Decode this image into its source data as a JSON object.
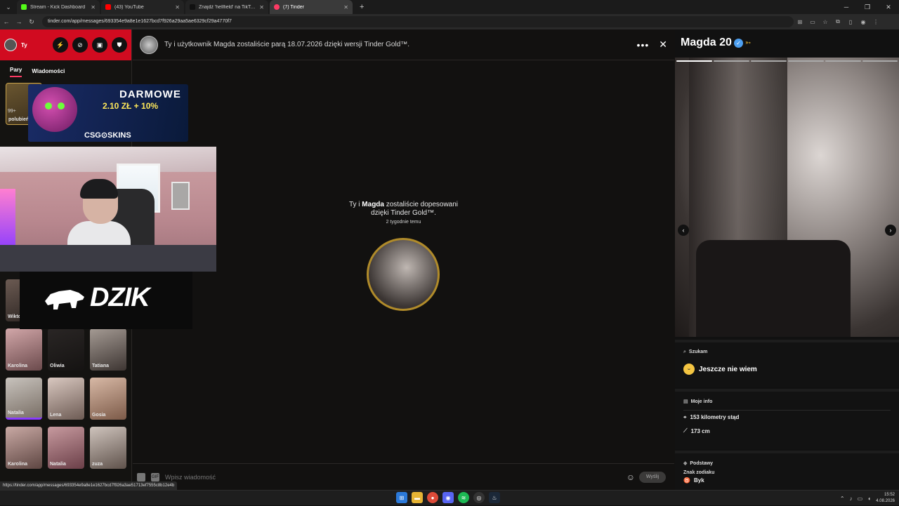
{
  "browser": {
    "tabs": [
      {
        "title": "Stream - Kick Dashboard",
        "color": "#53fc18"
      },
      {
        "title": "(43) YouTube",
        "color": "#ff0000"
      },
      {
        "title": "Znajdź 'hellfield' na TikTok | Wy...",
        "color": "#111111"
      },
      {
        "title": "(7) Tinder",
        "color": "#fd3a64"
      }
    ],
    "url": "tinder.com/app/messages/693354e9a8e1e1627bcd7f926a29aa5ae6329cf29a4770f7",
    "new_tab": "+"
  },
  "sidebar": {
    "user_name": "Ty",
    "tabs": [
      "Pary",
      "Wiadomości"
    ],
    "likes_count": "99+",
    "likes_label": "polubień",
    "matches": [
      {
        "name": "Wiktoria"
      },
      {
        "name": "Karolina"
      },
      {
        "name": "Oliwia"
      },
      {
        "name": "Tatiana"
      },
      {
        "name": "Natalia"
      },
      {
        "name": "Lena"
      },
      {
        "name": "Gosia"
      },
      {
        "name": "Karolina"
      },
      {
        "name": "Natalia"
      },
      {
        "name": "zuza"
      }
    ]
  },
  "overlay": {
    "ad_line1": "DARMOWE",
    "ad_line2": "2.10 ZŁ + 10%",
    "ad_brand": "CSG⊙SKINS",
    "logo_text": "DZIK"
  },
  "chat": {
    "header_text": "Ty i użytkownik Magda zostaliście parą 18.07.2026 dzięki wersji Tinder Gold™.",
    "match_line_prefix": "Ty i",
    "match_name": "Magda",
    "match_line_suffix": "zostaliście dopesowani",
    "match_line2": "dzięki Tinder Gold™.",
    "match_time": "2 tygodnie temu",
    "input_placeholder": "Wpisz wiadomość",
    "send_label": "Wyślij",
    "gif_label": "GIF"
  },
  "profile": {
    "name": "Magda 20",
    "photo_segments": 6,
    "active_segment": 0,
    "seeking_title": "Szukam",
    "seeking_value": "Jeszcze nie wiem",
    "info_title": "Moje info",
    "distance": "153 kilometry stąd",
    "height": "173 cm",
    "basics_title": "Podstawy",
    "zodiac_label": "Znak zodiaku",
    "zodiac_value": "Byk"
  },
  "status_url": "https://tinder.com/app/messages/693354e9a8e1e1627bcd7f926a3ae51713ef7555c8b12e4b",
  "taskbar": {
    "time": "15:52",
    "date": "4.08.2026"
  },
  "colors": {
    "tinder_red": "#d10b20",
    "gold": "#b08b2a",
    "verified_blue": "#4d9ff0"
  }
}
